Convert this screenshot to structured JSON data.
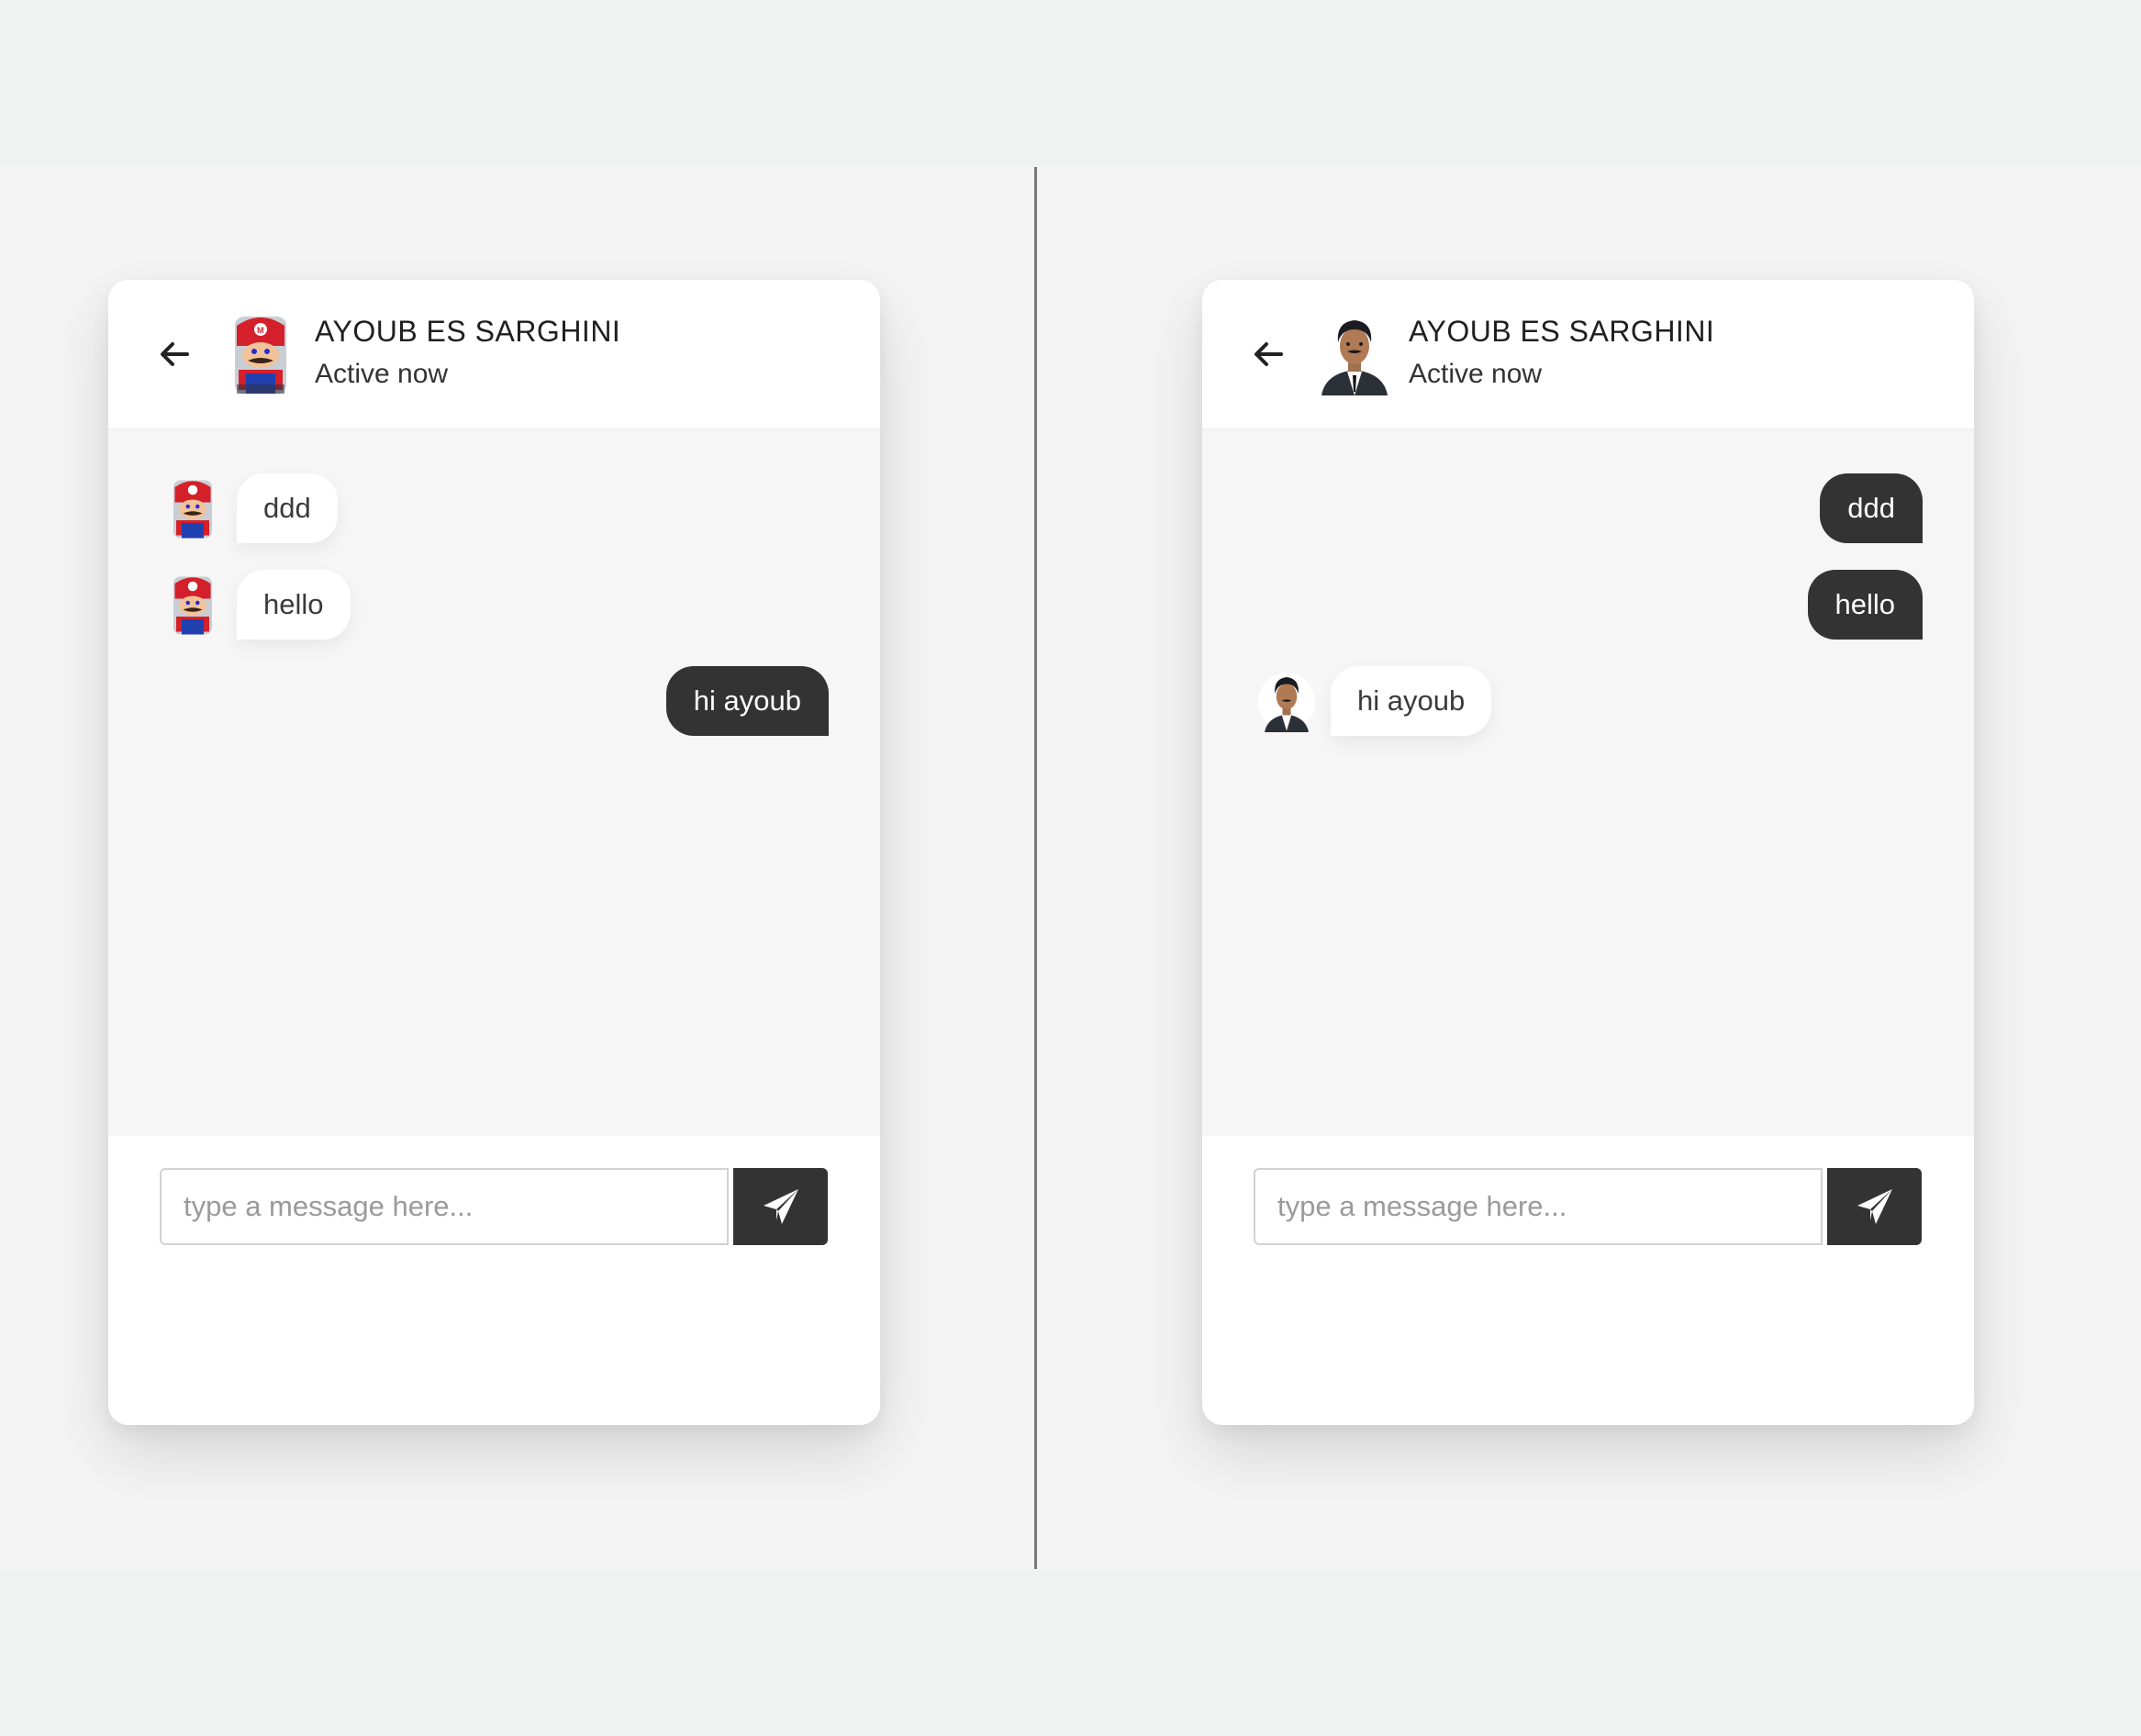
{
  "windows": [
    {
      "header": {
        "back_icon": "arrow-left-icon",
        "avatar": "mario-avatar",
        "name": "AYOUB ES SARGHINI",
        "status": "Active now"
      },
      "messages": [
        {
          "direction": "incoming",
          "text": "ddd"
        },
        {
          "direction": "incoming",
          "text": "hello"
        },
        {
          "direction": "outgoing",
          "text": "hi ayoub"
        }
      ],
      "composer": {
        "placeholder": "type a message here...",
        "send_icon": "paper-plane-icon"
      }
    },
    {
      "header": {
        "back_icon": "arrow-left-icon",
        "avatar": "man-in-suit-avatar",
        "name": "AYOUB ES SARGHINI",
        "status": "Active now"
      },
      "messages": [
        {
          "direction": "outgoing",
          "text": "ddd"
        },
        {
          "direction": "outgoing",
          "text": "hello"
        },
        {
          "direction": "incoming",
          "text": "hi ayoub"
        }
      ],
      "composer": {
        "placeholder": "type a message here...",
        "send_icon": "paper-plane-icon"
      }
    }
  ],
  "colors": {
    "outgoing_bubble": "#333333",
    "incoming_bubble": "#ffffff",
    "chat_background": "#f6f6f6"
  }
}
